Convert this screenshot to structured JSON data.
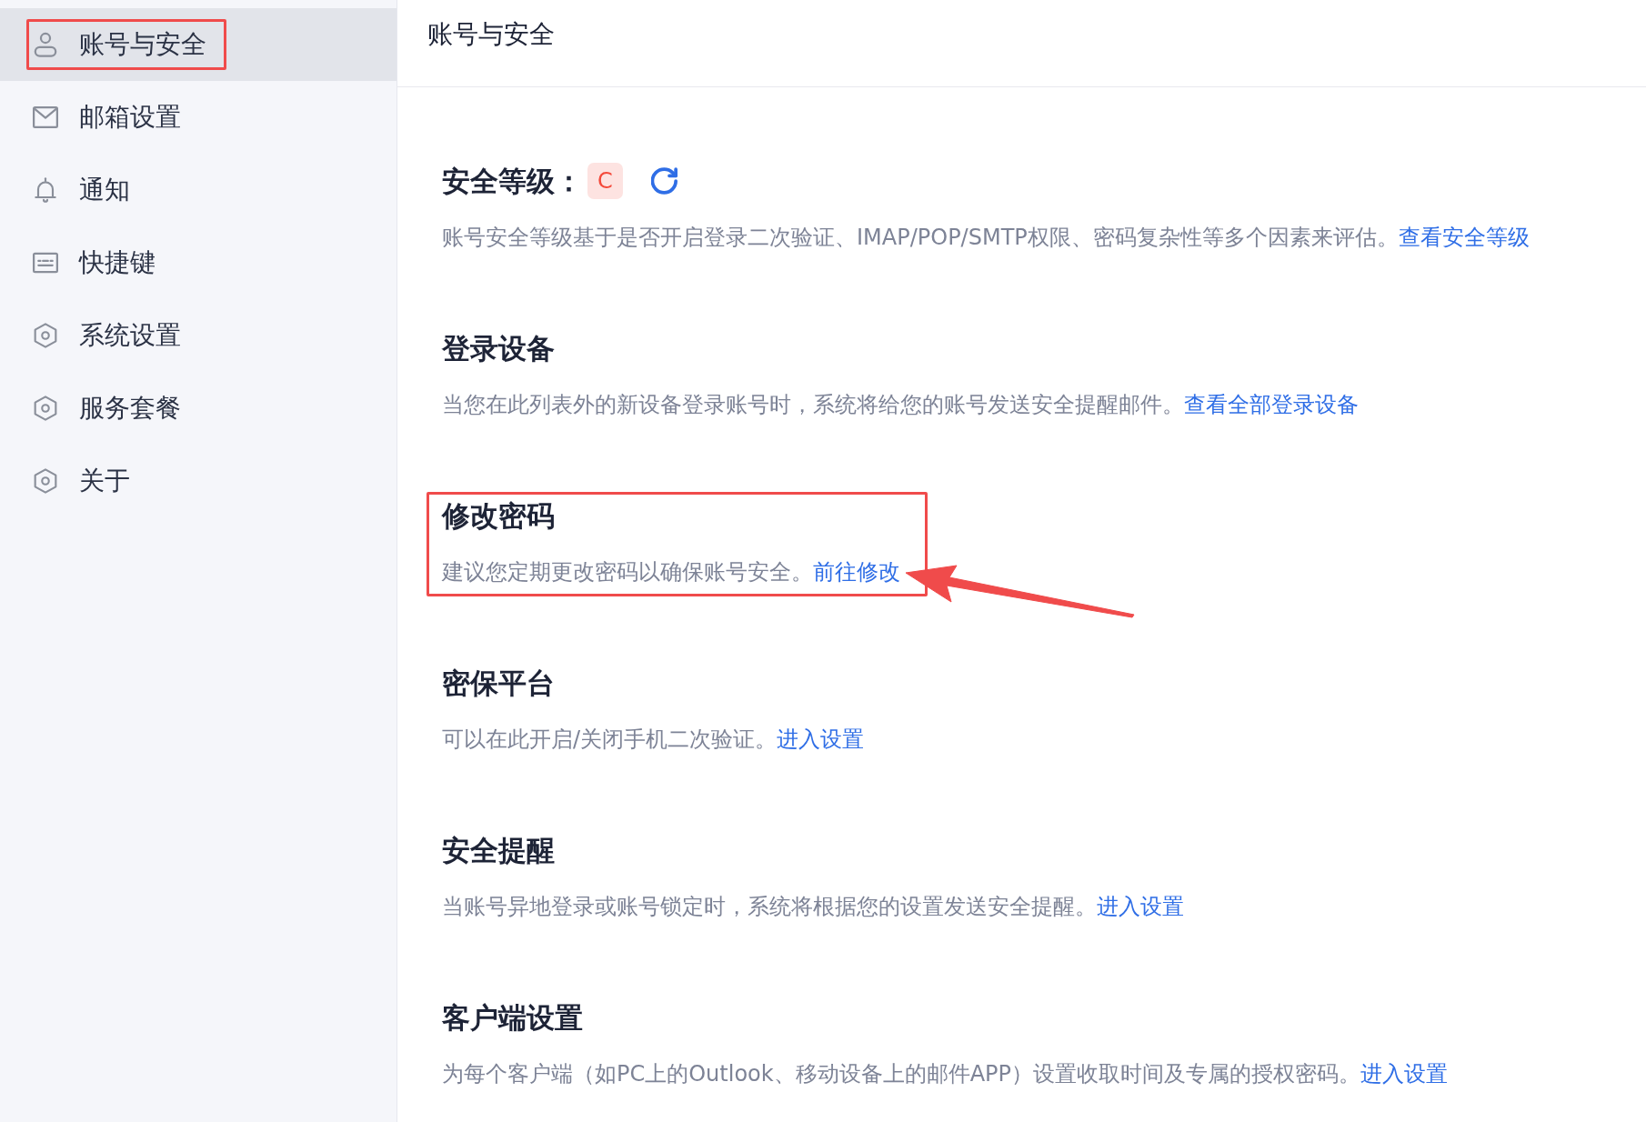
{
  "sidebar": {
    "items": [
      {
        "label": "账号与安全",
        "selected": true,
        "highlighted": true
      },
      {
        "label": "邮箱设置",
        "selected": false,
        "highlighted": false
      },
      {
        "label": "通知",
        "selected": false,
        "highlighted": false
      },
      {
        "label": "快捷键",
        "selected": false,
        "highlighted": false
      },
      {
        "label": "系统设置",
        "selected": false,
        "highlighted": false
      },
      {
        "label": "服务套餐",
        "selected": false,
        "highlighted": false
      },
      {
        "label": "关于",
        "selected": false,
        "highlighted": false
      }
    ]
  },
  "main": {
    "title": "账号与安全",
    "sections": [
      {
        "kind": "level",
        "title": "安全等级：",
        "badge": "C",
        "description": "账号安全等级基于是否开启登录二次验证、IMAP/POP/SMTP权限、密码复杂性等多个因素来评估。",
        "link": "查看安全等级",
        "highlighted": false,
        "arrow": false
      },
      {
        "kind": "plain",
        "title": "登录设备",
        "description": "当您在此列表外的新设备登录账号时，系统将给您的账号发送安全提醒邮件。",
        "link": "查看全部登录设备",
        "highlighted": false,
        "arrow": false
      },
      {
        "kind": "plain",
        "title": "修改密码",
        "description": "建议您定期更改密码以确保账号安全。",
        "link": "前往修改",
        "highlighted": true,
        "arrow": true
      },
      {
        "kind": "plain",
        "title": "密保平台",
        "description": "可以在此开启/关闭手机二次验证。",
        "link": "进入设置",
        "highlighted": false,
        "arrow": false
      },
      {
        "kind": "plain",
        "title": "安全提醒",
        "description": "当账号异地登录或账号锁定时，系统将根据您的设置发送安全提醒。",
        "link": "进入设置",
        "highlighted": false,
        "arrow": false
      },
      {
        "kind": "plain",
        "title": "客户端设置",
        "description": "为每个客户端（如PC上的Outlook、移动设备上的邮件APP）设置收取时间及专属的授权密码。",
        "link": "进入设置",
        "highlighted": false,
        "arrow": false
      }
    ]
  }
}
